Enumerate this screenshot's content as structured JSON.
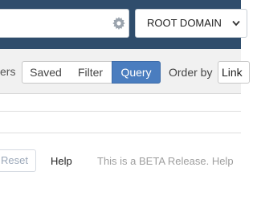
{
  "header": {
    "search": {
      "value": ""
    },
    "domain_select": {
      "selected": "ROOT DOMAIN"
    }
  },
  "filter_bar": {
    "partial_label": "ers",
    "modes": [
      {
        "label": "Saved",
        "active": false
      },
      {
        "label": "Filter",
        "active": false
      },
      {
        "label": "Query",
        "active": true
      }
    ],
    "order_by": {
      "label": "Order by",
      "selected": "Link"
    }
  },
  "query": {
    "value": ""
  },
  "actions": {
    "reset_label": "Reset",
    "help_label": "Help",
    "beta_notice": "This is a BETA Release. Help"
  },
  "colors": {
    "header_bg": "#2f4d6c",
    "active_mode_bg": "#4a7dbf",
    "filter_bar_bg": "#f1f1f1"
  },
  "icons": {
    "search_settings": "gear-icon",
    "domain_dropdown": "chevron-down-icon"
  }
}
